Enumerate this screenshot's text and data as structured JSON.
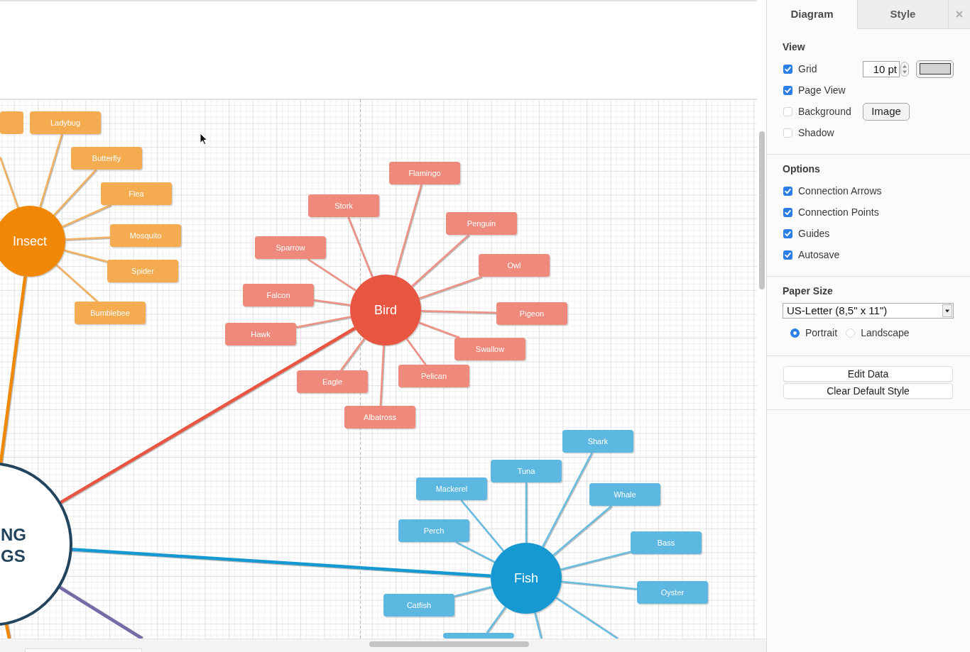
{
  "diagram": {
    "center": {
      "label_lines": [
        "NG",
        "GS"
      ]
    },
    "topics": [
      {
        "kind": "topic",
        "label": "Insect",
        "color": "#f08705",
        "children": [
          {
            "kind": "clipped"
          },
          {
            "kind": "box",
            "label": "Ladybug"
          },
          {
            "kind": "box",
            "label": "Butterfly"
          },
          {
            "kind": "box",
            "label": "Flea"
          },
          {
            "kind": "box",
            "label": "Mosquito"
          },
          {
            "kind": "box",
            "label": "Spider"
          },
          {
            "kind": "box",
            "label": "Bumblebee"
          }
        ]
      },
      {
        "kind": "topic",
        "label": "Bird",
        "color": "#e85642",
        "children": [
          {
            "kind": "box",
            "label": "Flamingo"
          },
          {
            "kind": "box",
            "label": "Stork"
          },
          {
            "kind": "box",
            "label": "Penguin"
          },
          {
            "kind": "box",
            "label": "Sparrow"
          },
          {
            "kind": "box",
            "label": "Owl"
          },
          {
            "kind": "box",
            "label": "Falcon"
          },
          {
            "kind": "box",
            "label": "Pigeon"
          },
          {
            "kind": "box",
            "label": "Hawk"
          },
          {
            "kind": "box",
            "label": "Swallow"
          },
          {
            "kind": "box",
            "label": "Pelican"
          },
          {
            "kind": "box",
            "label": "Eagle"
          },
          {
            "kind": "box",
            "label": "Albatross"
          }
        ]
      },
      {
        "kind": "topic",
        "label": "Fish",
        "color": "#1699d3",
        "children": [
          {
            "kind": "box",
            "label": "Shark"
          },
          {
            "kind": "box",
            "label": "Tuna"
          },
          {
            "kind": "box",
            "label": "Mackerel"
          },
          {
            "kind": "box",
            "label": "Whale"
          },
          {
            "kind": "box",
            "label": "Perch"
          },
          {
            "kind": "box",
            "label": "Bass"
          },
          {
            "kind": "box",
            "label": "Oyster"
          },
          {
            "kind": "box",
            "label": "Catfish"
          },
          {
            "kind": "clipped"
          },
          {
            "kind": "line"
          },
          {
            "kind": "line"
          }
        ]
      },
      {
        "kind": "line",
        "color": "#736ca8"
      },
      {
        "kind": "line",
        "color": "#f08705"
      }
    ]
  },
  "panel": {
    "tabs": [
      {
        "label": "Diagram",
        "selected": true
      },
      {
        "label": "Style",
        "selected": false
      }
    ],
    "view": {
      "title": "View",
      "items": [
        {
          "kind": "grid",
          "label": "Grid",
          "checked": true,
          "value": "10 pt"
        },
        {
          "kind": "check",
          "label": "Page View",
          "checked": true
        },
        {
          "kind": "image",
          "label": "Background",
          "checked": false,
          "button": "Image"
        },
        {
          "kind": "check",
          "label": "Shadow",
          "checked": false
        }
      ]
    },
    "options": {
      "title": "Options",
      "items": [
        {
          "label": "Connection Arrows",
          "checked": true
        },
        {
          "label": "Connection Points",
          "checked": true
        },
        {
          "label": "Guides",
          "checked": true
        },
        {
          "label": "Autosave",
          "checked": true
        }
      ]
    },
    "paper_size": {
      "title": "Paper Size",
      "value": "US-Letter (8,5\" x 11\")",
      "orientations": [
        {
          "label": "Portrait",
          "selected": true
        },
        {
          "label": "Landscape",
          "selected": false
        }
      ]
    },
    "buttons": [
      "Edit Data",
      "Clear Default Style"
    ]
  }
}
